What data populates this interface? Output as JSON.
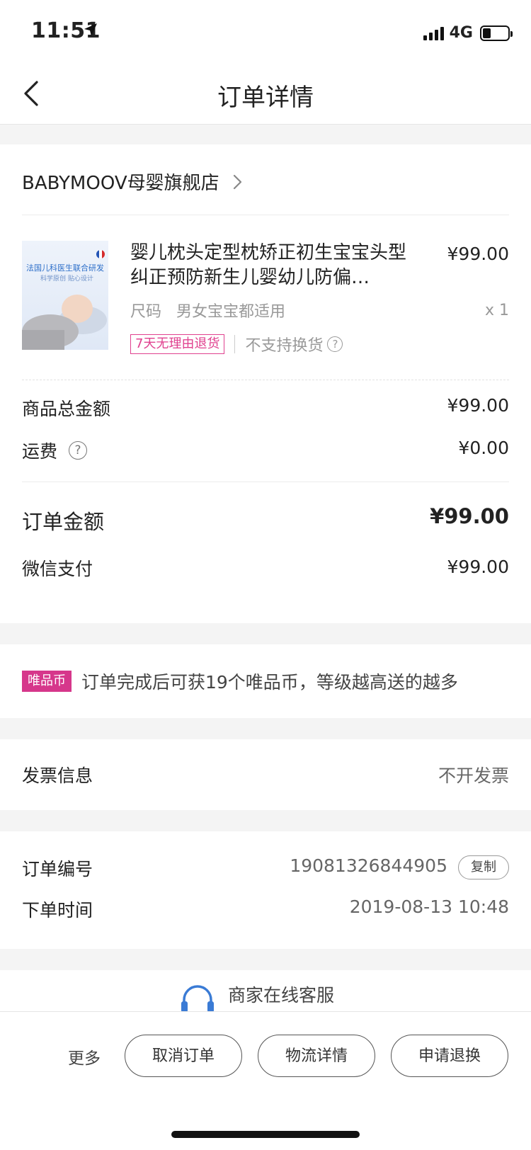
{
  "status_bar": {
    "time": "11:51",
    "network": "4G"
  },
  "nav": {
    "title": "订单详情"
  },
  "store": {
    "name": "BABYMOOV母婴旗舰店"
  },
  "product": {
    "title": "婴儿枕头定型枕矫正初生宝宝头型纠正预防新生儿婴幼儿防偏…",
    "price": "¥99.00",
    "spec_label": "尺码",
    "spec_value": "男女宝宝都适用",
    "quantity": "x 1",
    "image_text_1": "法国儿科医生联合研发",
    "image_text_2": "科学原创 贴心设计",
    "tag_return": "7天无理由退货",
    "tag_no_exchange": "不支持换货",
    "help_mark": "?"
  },
  "amounts": {
    "subtotal_label": "商品总金额",
    "subtotal_value": "¥99.00",
    "freight_label": "运费",
    "freight_value": "¥0.00",
    "total_label": "订单金额",
    "total_value": "¥99.00",
    "payment_label": "微信支付",
    "payment_value": "¥99.00"
  },
  "coins": {
    "badge": "唯品币",
    "text": "订单完成后可获19个唯品币，等级越高送的越多"
  },
  "invoice": {
    "label": "发票信息",
    "value": "不开发票"
  },
  "order_info": {
    "number_label": "订单编号",
    "number_value": "19081326844905",
    "copy_label": "复制",
    "time_label": "下单时间",
    "time_value": "2019-08-13 10:48"
  },
  "service": {
    "label": "商家在线客服"
  },
  "bottom_bar": {
    "more": "更多",
    "cancel": "取消订单",
    "logistics": "物流详情",
    "refund": "申请退换"
  },
  "colors": {
    "accent_pink": "#d6378b",
    "service_blue": "#3a7bd5"
  }
}
